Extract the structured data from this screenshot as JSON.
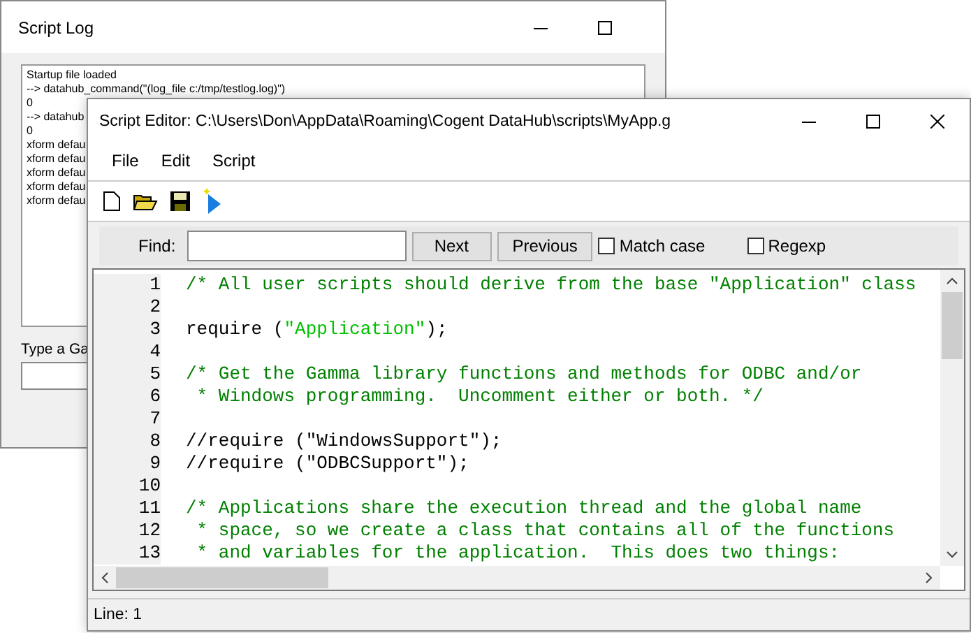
{
  "log_window": {
    "title": "Script Log",
    "log_lines": [
      "Startup file loaded",
      "--> datahub_command(\"(log_file c:/tmp/testlog.log)\")",
      "0",
      "--> datahub",
      "0",
      "xform defau",
      "xform defau",
      "xform defau",
      "xform defau",
      "xform defau"
    ],
    "prompt_label": "Type a Ga"
  },
  "editor_window": {
    "title": "Script Editor: C:\\Users\\Don\\AppData\\Roaming\\Cogent DataHub\\scripts\\MyApp.g",
    "menu": [
      "File",
      "Edit",
      "Script"
    ],
    "find": {
      "label": "Find:",
      "buttons": [
        "Next",
        "Previous"
      ],
      "options": [
        {
          "label": "Match case",
          "checked": false
        },
        {
          "label": "Regexp",
          "checked": false
        }
      ]
    },
    "code_lines": [
      {
        "number": "1",
        "segments": [
          {
            "kind": "comment",
            "text": "/* All user scripts should derive from the base \"Application\" class"
          }
        ]
      },
      {
        "number": "2"
      },
      {
        "number": "3",
        "segments": [
          {
            "kind": "code",
            "text": "require ("
          },
          {
            "kind": "string",
            "text": "\"Application\""
          },
          {
            "kind": "code",
            "text": ");"
          }
        ]
      },
      {
        "number": "4"
      },
      {
        "number": "5",
        "segments": [
          {
            "kind": "comment",
            "text": "/* Get the Gamma library functions and methods for ODBC and/or"
          }
        ]
      },
      {
        "number": "6",
        "segments": [
          {
            "kind": "comment",
            "text": " * Windows programming.  Uncomment either or both. */"
          }
        ]
      },
      {
        "number": "7"
      },
      {
        "number": "8",
        "segments": [
          {
            "kind": "code",
            "text": "//require (\"WindowsSupport\");"
          }
        ]
      },
      {
        "number": "9",
        "segments": [
          {
            "kind": "code",
            "text": "//require (\"ODBCSupport\");"
          }
        ]
      },
      {
        "number": "10"
      },
      {
        "number": "11",
        "segments": [
          {
            "kind": "comment",
            "text": "/* Applications share the execution thread and the global name"
          }
        ]
      },
      {
        "number": "12",
        "segments": [
          {
            "kind": "comment",
            "text": " * space, so we create a class that contains all of the functions"
          }
        ]
      },
      {
        "number": "13",
        "segments": [
          {
            "kind": "comment",
            "text": " * and variables for the application.  This does two things:"
          }
        ]
      }
    ],
    "status": "Line: 1"
  }
}
